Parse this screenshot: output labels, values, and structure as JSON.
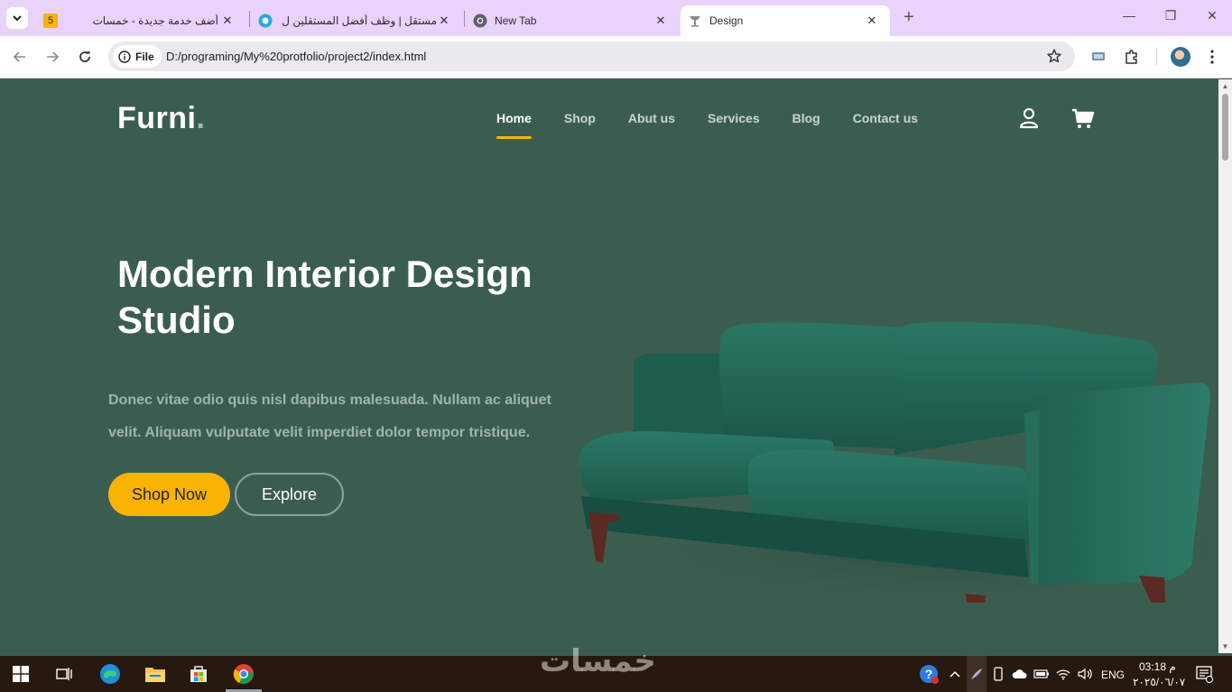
{
  "browser": {
    "tabs": [
      {
        "title": "أضف خدمة جديدة - خمسات",
        "favicon": "khamsat-icon",
        "badge": "5",
        "active": false
      },
      {
        "title": "مستقل | وظف أفضل المستقلين ل",
        "favicon": "mostaql-icon",
        "active": false
      },
      {
        "title": "New Tab",
        "favicon": "chrome-icon",
        "active": false
      },
      {
        "title": "Design",
        "favicon": "design-icon",
        "active": true
      }
    ],
    "security_label": "File",
    "url": "D:/programing/My%20protfolio/project2/index.html"
  },
  "site": {
    "logo": "Furni",
    "logo_dot": ".",
    "nav": [
      {
        "label": "Home",
        "active": true
      },
      {
        "label": "Shop"
      },
      {
        "label": "Abut us"
      },
      {
        "label": "Services"
      },
      {
        "label": "Blog"
      },
      {
        "label": "Contact us"
      }
    ],
    "hero": {
      "title": "Modern Interior Design Studio",
      "text": "Donec vitae odio quis nisl dapibus malesuada. Nullam ac aliquet velit. Aliquam vulputate velit imperdiet dolor tempor tristique.",
      "primary_button": "Shop Now",
      "secondary_button": "Explore"
    },
    "colors": {
      "background": "#3b5d50",
      "accent": "#f9b300",
      "sofa": "#1f5a4c"
    }
  },
  "taskbar": {
    "watermark": "خمسات",
    "language": "ENG",
    "time": "03:18 م",
    "date": "٢٠٢٥/٠٦/٠٧"
  }
}
